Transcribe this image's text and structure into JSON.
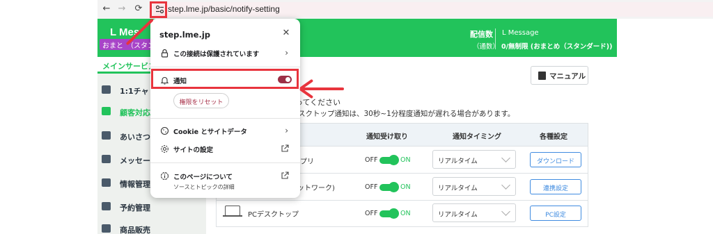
{
  "browser": {
    "back_glyph": "←",
    "forward_glyph": "→",
    "reload_glyph": "⟳",
    "url": "step.lme.jp/basic/notify-setting"
  },
  "header": {
    "app_name": "L Mes",
    "plan_badge": "おまと　（スタン",
    "delivery_label": "配信数",
    "delivery_sub": "（通数）",
    "plan_name": "L Message",
    "plan_limit": "0/無制限 (おまとめ（スタンダード))",
    "brand_color": "#22c35b"
  },
  "sidebar": {
    "title": "メインサービス",
    "items": [
      {
        "label": "1:1チャ",
        "icon": "chat-icon"
      },
      {
        "label": "顧客対応",
        "icon": "arrow-icon",
        "active": true
      },
      {
        "label": "あいさつ",
        "icon": "message-icon"
      },
      {
        "label": "メッセー",
        "icon": "edit-icon"
      },
      {
        "label": "情報管理",
        "icon": "tag-icon"
      },
      {
        "label": "予約管理",
        "icon": "calendar-icon"
      },
      {
        "label": "商品販売",
        "icon": "cart-icon"
      }
    ]
  },
  "main": {
    "manual_label": "マニュアル",
    "intro_line1": "ってください",
    "intro_line2": "スクトップ通知は、30秒~1分程度通知が遅れる場合があります。",
    "table": {
      "headers": [
        "通知受け取り",
        "通知タイミング",
        "各種設定"
      ],
      "rows": [
        {
          "name": "プリ",
          "off": "OFF",
          "on": "ON",
          "timing": "リアルタイム",
          "action": "ダウンロード"
        },
        {
          "name": "ットワーク)",
          "off": "OFF",
          "on": "ON",
          "timing": "リアルタイム",
          "action": "連携設定"
        },
        {
          "name": "PCデスクトップ",
          "off": "OFF",
          "on": "ON",
          "timing": "リアルタイム",
          "action": "PC設定"
        }
      ]
    }
  },
  "popup": {
    "host": "step.lme.jp",
    "close_glyph": "✕",
    "connection": "この接続は保護されています",
    "notification": "通知",
    "notification_on": true,
    "reset": "権限をリセット",
    "cookie": "Cookie とサイトデータ",
    "site_settings": "サイトの設定",
    "about": "このページについて",
    "about_sub": "ソースとトピックの詳細",
    "accent_color": "#9c2f46"
  }
}
